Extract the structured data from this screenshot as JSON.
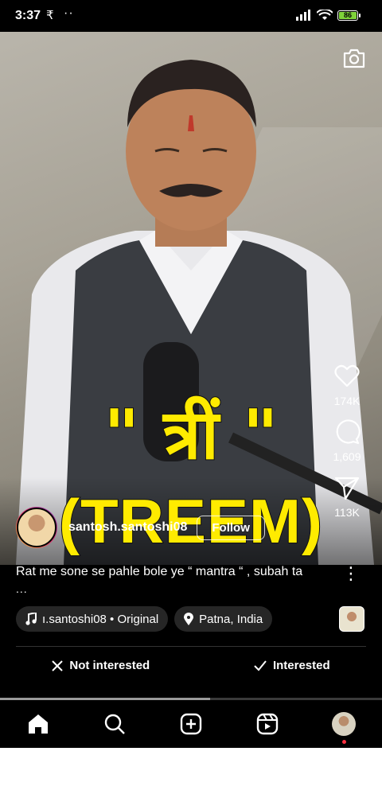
{
  "status_bar": {
    "time": "3:37",
    "battery": "86"
  },
  "post": {
    "caption_overlay_line1": "\" त्रीं \"",
    "caption_overlay_line2": "(TREEM)",
    "username": "santosh.santoshi08",
    "follow_label": "Follow",
    "description": "Rat me sone se pahle bole ye “ mantra “ , subah ta",
    "description_more": "...",
    "audio_label": "ı.santoshi08 • Original",
    "location_label": "Patna, India",
    "likes": "174K",
    "comments": "1,609",
    "shares": "113K",
    "progress_fraction": 0.55
  },
  "feedback": {
    "not_interested": "Not interested",
    "interested": "Interested"
  },
  "nav": {
    "items": [
      "home-icon",
      "search-icon",
      "create-icon",
      "reels-icon",
      "profile-avatar"
    ]
  },
  "colors": {
    "caption_yellow": "#ffeb00",
    "notification_red": "#ff3040",
    "battery_green": "#7fd33a"
  }
}
